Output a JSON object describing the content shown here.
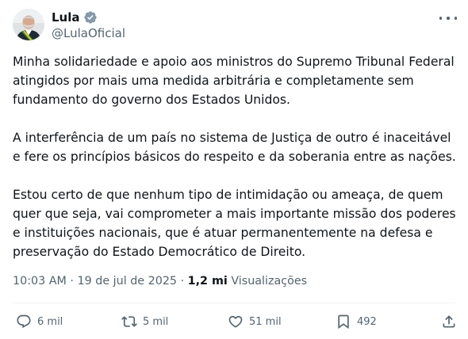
{
  "author": {
    "display_name": "Lula",
    "handle": "@LulaOficial",
    "verified_icon": "verified-badge-icon"
  },
  "menu": {
    "icon": "more-options-icon"
  },
  "tweet": {
    "paragraphs": [
      "Minha solidariedade e apoio aos ministros do Supremo Tribunal Federal atingidos por mais uma medida arbitrária e completamente sem fundamento do governo dos Estados Unidos.",
      "A interferência de um país no sistema de Justiça de outro é inaceitável e fere os princípios básicos do respeito e da soberania entre as nações.",
      "Estou certo de que nenhum tipo de intimidação ou ameaça, de quem quer que seja, vai comprometer a mais importante missão dos poderes e instituições nacionais, que é atuar permanentemente na defesa e preservação do Estado Democrático de Direito."
    ],
    "time": "10:03 AM",
    "separator": "·",
    "date": "19 de jul de 2025",
    "views_count": "1,2 mi",
    "views_label": "Visualizações"
  },
  "actions": {
    "replies": "6 mil",
    "reposts": "5 mil",
    "likes": "51 mil",
    "bookmarks": "492"
  },
  "colors": {
    "text": "#0f1419",
    "muted": "#536471",
    "divider": "#eff3f4",
    "verified": "#829aab"
  }
}
